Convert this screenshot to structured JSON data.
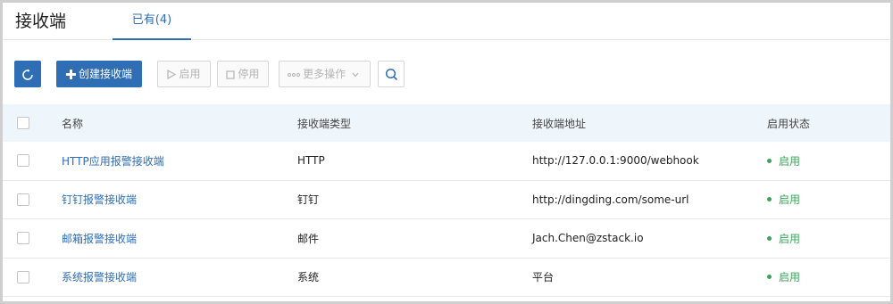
{
  "header": {
    "title": "接收端",
    "tab_label": "已有(4)"
  },
  "toolbar": {
    "refresh_icon": "refresh-icon",
    "create_label": "创建接收端",
    "enable_label": "启用",
    "disable_label": "停用",
    "more_label": "更多操作",
    "search_icon": "search-icon"
  },
  "table": {
    "columns": [
      "名称",
      "接收端类型",
      "接收端地址",
      "启用状态"
    ],
    "rows": [
      {
        "name": "HTTP应用报警接收端",
        "type": "HTTP",
        "address": "http://127.0.0.1:9000/webhook",
        "status": "启用"
      },
      {
        "name": "钉钉报警接收端",
        "type": "钉钉",
        "address": "http://dingding.com/some-url",
        "status": "启用"
      },
      {
        "name": "邮箱报警接收端",
        "type": "邮件",
        "address": "Jach.Chen@zstack.io",
        "status": "启用"
      },
      {
        "name": "系统报警接收端",
        "type": "系统",
        "address": "平台",
        "status": "启用"
      }
    ]
  },
  "colors": {
    "primary": "#2f6db5",
    "status_enabled": "#3aa55a",
    "header_bg": "#eef5fb"
  }
}
